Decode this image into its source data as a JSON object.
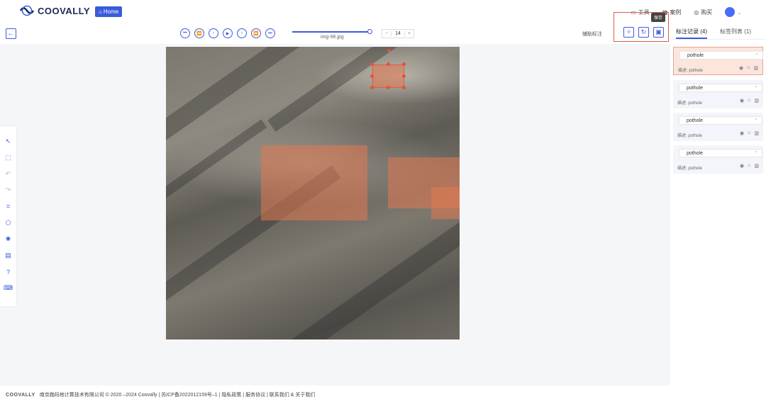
{
  "brand": {
    "name": "COOVALLY",
    "home_label": "Home"
  },
  "topnav": {
    "tools": "工具",
    "examples": "案例",
    "buy": "购买"
  },
  "toolbar": {
    "filename": "img-98.jpg",
    "frame_value": "14",
    "minus": "−",
    "plus": "+",
    "assist_label": "辅助标注",
    "progress": 1.0
  },
  "tooltip": {
    "save": "保存"
  },
  "sidebar": {
    "tabs": [
      {
        "label": "标注记录 (4)"
      },
      {
        "label": "标签列表 (1)"
      }
    ],
    "records": [
      {
        "label": "pothole",
        "desc": "描述: pothole",
        "active": true
      },
      {
        "label": "pothole",
        "desc": "描述: pothole",
        "active": false
      },
      {
        "label": "pothole",
        "desc": "描述: pothole",
        "active": false
      },
      {
        "label": "pothole",
        "desc": "描述: pothole",
        "active": false
      }
    ]
  },
  "footer": {
    "brand": "COOVALLY",
    "text": "南京跑码地计算技术有限公司 © 2020 –2024 Coovally | 苏ICP备2022012159号–1 | 隐私政策 | 服务协议 | 联系我们 & 关于我们"
  },
  "colors": {
    "accent": "#3b5bdb",
    "annotation": "#e05a4a"
  },
  "icons": [
    "back-arrow-icon",
    "first-icon",
    "prev-fast-icon",
    "prev-icon",
    "play-icon",
    "next-icon",
    "next-fast-icon",
    "last-icon",
    "pin-icon",
    "refresh-icon",
    "save-icon",
    "eye-icon",
    "lock-icon",
    "trash-icon"
  ]
}
